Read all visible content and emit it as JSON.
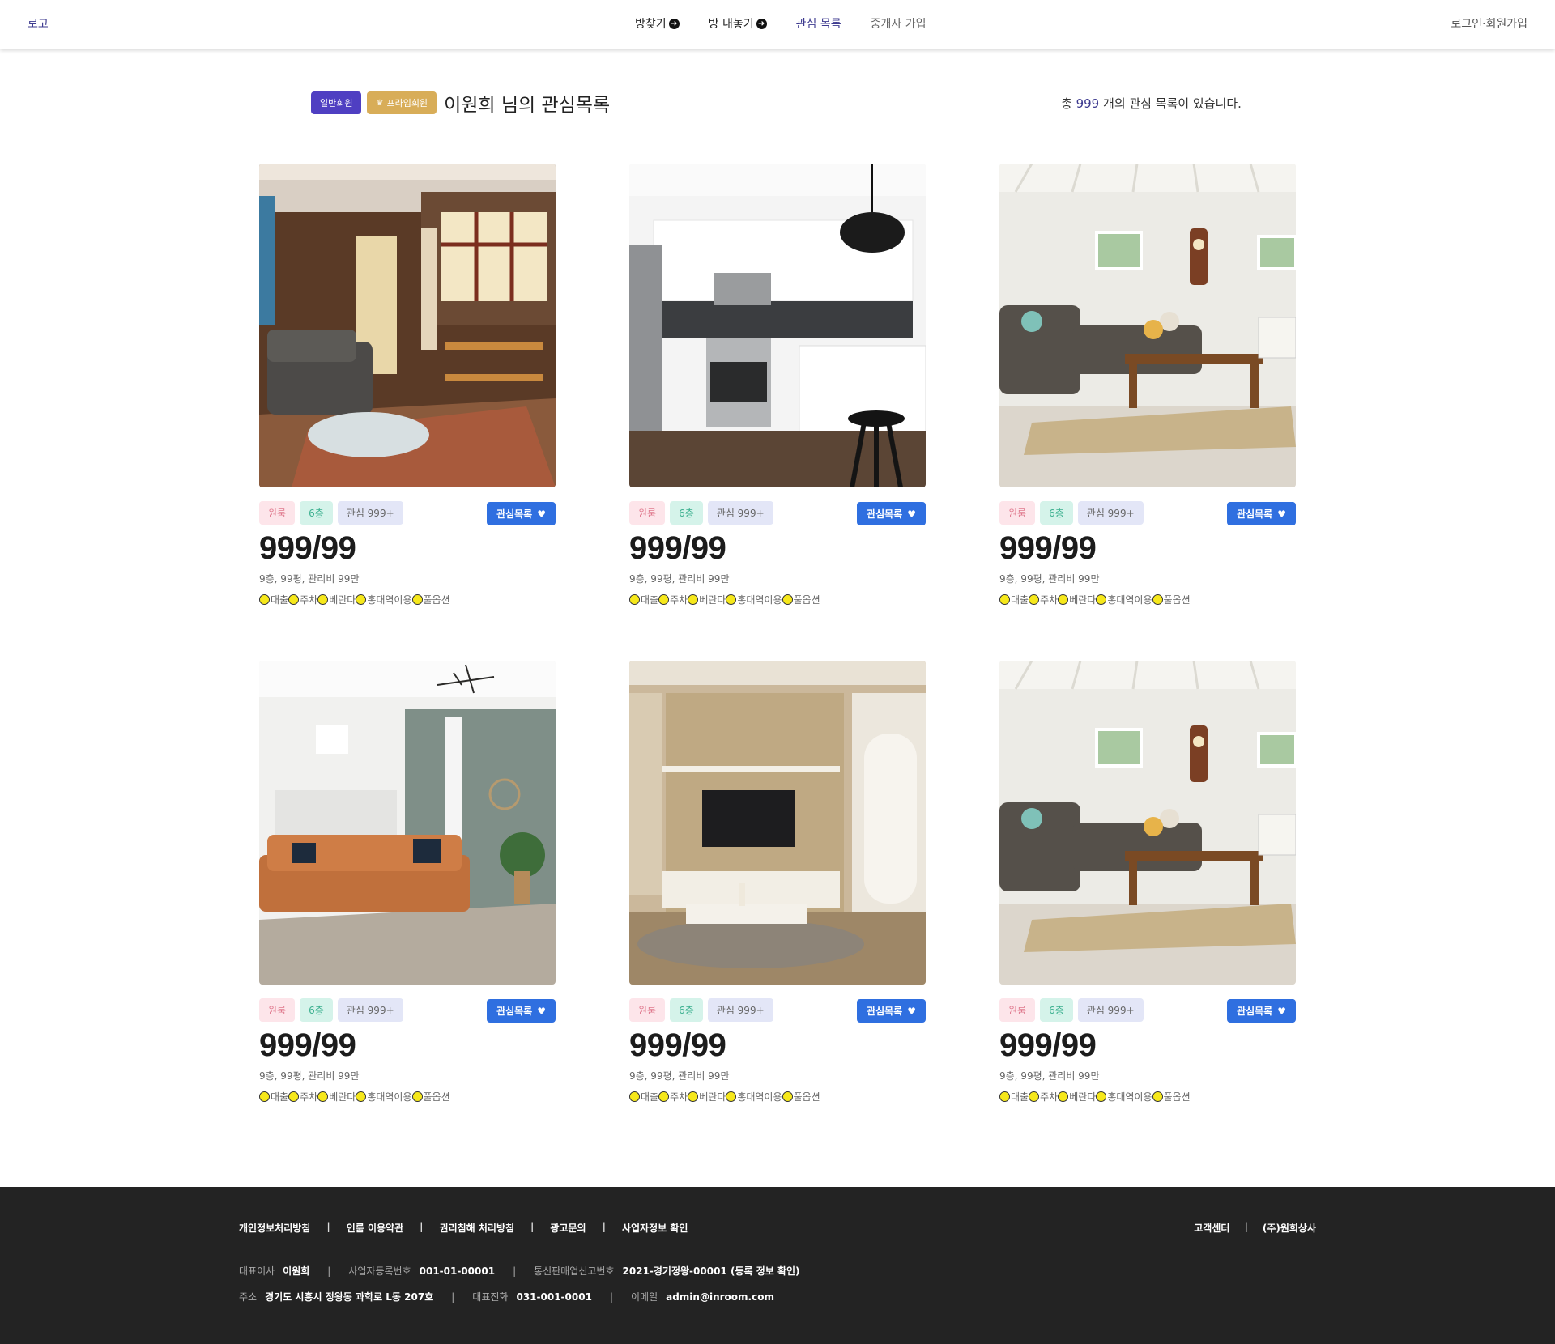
{
  "header": {
    "logo": "로고",
    "nav": [
      {
        "label": "방찾기",
        "arrow": true
      },
      {
        "label": "방 내놓기",
        "arrow": true
      },
      {
        "label": "관심 목록",
        "arrow": false
      },
      {
        "label": "중개사 가입",
        "arrow": false
      }
    ],
    "auth": "로그인·회원가입"
  },
  "title": {
    "badge_basic": "일반회원",
    "badge_premium": "프라임회원",
    "text": "이원희 님의 관심목록",
    "count_prefix": "총",
    "count": "999",
    "count_suffix": "개의 관심 목록이 있습니다."
  },
  "cards": [
    {
      "type": "원룸",
      "floor": "6층",
      "likes": "관심 999+",
      "button": "관심목록",
      "price": "999/99",
      "desc": "9층, 99평, 관리비 99만",
      "options": [
        "대출",
        "주차",
        "베란다",
        "홍대역이용",
        "풀옵션"
      ],
      "scene": "living-sunny"
    },
    {
      "type": "원룸",
      "floor": "6층",
      "likes": "관심 999+",
      "button": "관심목록",
      "price": "999/99",
      "desc": "9층, 99평, 관리비 99만",
      "options": [
        "대출",
        "주차",
        "베란다",
        "홍대역이용",
        "풀옵션"
      ],
      "scene": "kitchen"
    },
    {
      "type": "원룸",
      "floor": "6층",
      "likes": "관심 999+",
      "button": "관심목록",
      "price": "999/99",
      "desc": "9층, 99평, 관리비 99만",
      "options": [
        "대출",
        "주차",
        "베란다",
        "홍대역이용",
        "풀옵션"
      ],
      "scene": "living-white"
    },
    {
      "type": "원룸",
      "floor": "6층",
      "likes": "관심 999+",
      "button": "관심목록",
      "price": "999/99",
      "desc": "9층, 99평, 관리비 99만",
      "options": [
        "대출",
        "주차",
        "베란다",
        "홍대역이용",
        "풀옵션"
      ],
      "scene": "living-leather"
    },
    {
      "type": "원룸",
      "floor": "6층",
      "likes": "관심 999+",
      "button": "관심목록",
      "price": "999/99",
      "desc": "9층, 99평, 관리비 99만",
      "options": [
        "대출",
        "주차",
        "베란다",
        "홍대역이용",
        "풀옵션"
      ],
      "scene": "tv-room"
    },
    {
      "type": "원룸",
      "floor": "6층",
      "likes": "관심 999+",
      "button": "관심목록",
      "price": "999/99",
      "desc": "9층, 99평, 관리비 99만",
      "options": [
        "대출",
        "주차",
        "베란다",
        "홍대역이용",
        "풀옵션"
      ],
      "scene": "living-white"
    }
  ],
  "footer": {
    "links": [
      "개인정보처리방침",
      "인룸 이용약관",
      "권리침해 처리방침",
      "광고문의",
      "사업자정보 확인"
    ],
    "right": [
      "고객센터",
      "(주)원희상사"
    ],
    "info_row1": [
      {
        "label": "대표이사",
        "value": "이원희"
      },
      {
        "label": "사업자등록번호",
        "value": "001-01-00001"
      },
      {
        "label": "통신판매업신고번호",
        "value": "2021-경기정왕-00001 (등록 정보 확인)"
      }
    ],
    "info_row2": [
      {
        "label": "주소",
        "value": "경기도 시흥시 정왕동 과학로 L동 207호"
      },
      {
        "label": "대표전화",
        "value": "031-001-0001"
      },
      {
        "label": "이메일",
        "value": "admin@inroom.com"
      }
    ]
  },
  "colors": {
    "accent": "#3d3a8f",
    "button_blue": "#2f6fe0",
    "badge_basic": "#4f3fc2",
    "badge_premium": "#d8ad58",
    "footer_bg": "#232323"
  }
}
